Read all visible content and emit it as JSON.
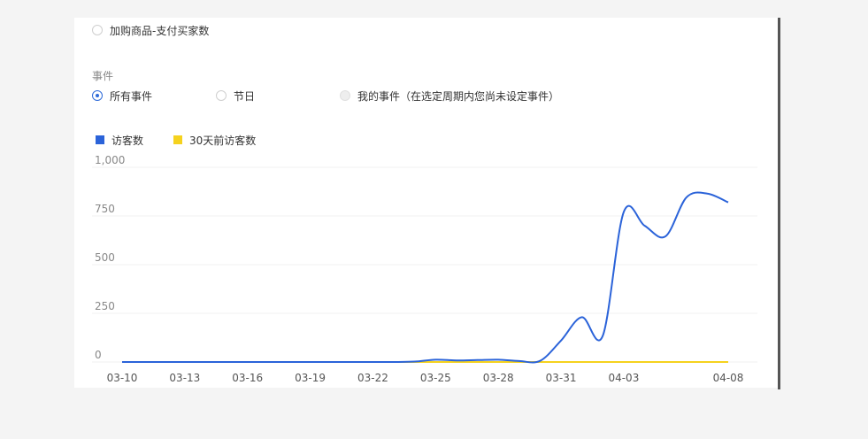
{
  "metric_option": {
    "label": "加购商品-支付买家数"
  },
  "event_section": {
    "title": "事件",
    "options": [
      {
        "label": "所有事件",
        "checked": true
      },
      {
        "label": "节日",
        "checked": false
      },
      {
        "label": "我的事件（在选定周期内您尚未设定事件）",
        "checked": false,
        "disabled": true
      }
    ]
  },
  "colors": {
    "visitors": "#2b63d9",
    "visitors_30d": "#f5d21e",
    "grid": "#f0f0f0"
  },
  "chart_data": {
    "type": "line",
    "title": "",
    "xlabel": "",
    "ylabel": "",
    "ylim": [
      0,
      1000
    ],
    "y_ticks": [
      "0",
      "250",
      "500",
      "750",
      "1,000"
    ],
    "y_tick_values": [
      0,
      250,
      500,
      750,
      1000
    ],
    "x_tick_labels": [
      "03-10",
      "03-13",
      "03-16",
      "03-19",
      "03-22",
      "03-25",
      "03-28",
      "03-31",
      "04-03",
      "04-08"
    ],
    "x_tick_index": [
      0,
      3,
      6,
      9,
      12,
      15,
      18,
      21,
      24,
      29
    ],
    "x": [
      "03-10",
      "03-11",
      "03-12",
      "03-13",
      "03-14",
      "03-15",
      "03-16",
      "03-17",
      "03-18",
      "03-19",
      "03-20",
      "03-21",
      "03-22",
      "03-23",
      "03-24",
      "03-25",
      "03-26",
      "03-27",
      "03-28",
      "03-29",
      "03-30",
      "03-31",
      "04-01",
      "04-02",
      "04-03",
      "04-04",
      "04-05",
      "04-06",
      "04-07",
      "04-08"
    ],
    "legend_position": "top-left",
    "series": [
      {
        "name": "访客数",
        "values": [
          0,
          0,
          0,
          0,
          0,
          0,
          0,
          0,
          0,
          0,
          0,
          0,
          0,
          0,
          2,
          12,
          8,
          10,
          12,
          5,
          6,
          110,
          230,
          135,
          770,
          700,
          645,
          845,
          865,
          820
        ]
      },
      {
        "name": "30天前访客数",
        "values": [
          0,
          0,
          0,
          0,
          0,
          0,
          0,
          0,
          0,
          0,
          0,
          0,
          0,
          0,
          0,
          0,
          0,
          0,
          0,
          0,
          0,
          0,
          0,
          0,
          0,
          0,
          0,
          0,
          0,
          0
        ]
      }
    ]
  }
}
